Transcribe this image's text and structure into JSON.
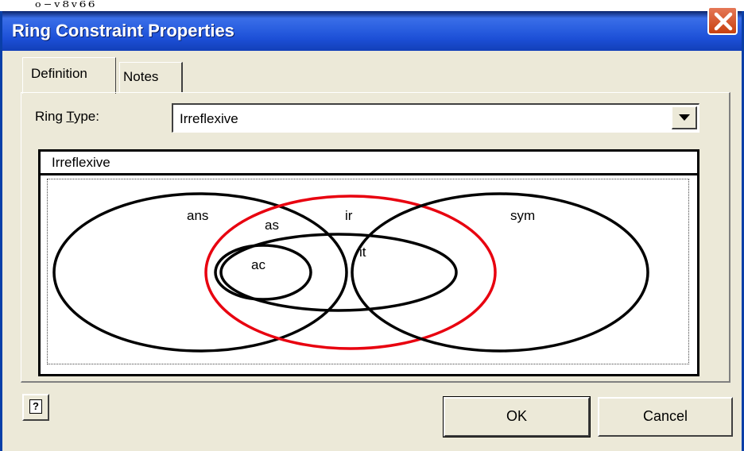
{
  "artifact_text": "ₒ₋ᵥ₈ᵥ₆₆",
  "window": {
    "title": "Ring Constraint Properties"
  },
  "tabs": [
    {
      "label": "Definition",
      "active": true
    },
    {
      "label": "Notes",
      "active": false
    }
  ],
  "ring_type": {
    "label_prefix": "Ring ",
    "label_accel": "T",
    "label_suffix": "ype:",
    "selected": "Irreflexive"
  },
  "diagram": {
    "header": "Irreflexive",
    "highlight_color": "#e8000f",
    "outline_color": "#000000",
    "sets": [
      {
        "id": "ans",
        "label": "ans"
      },
      {
        "id": "as",
        "label": "as"
      },
      {
        "id": "ir",
        "label": "ir",
        "highlighted": true
      },
      {
        "id": "sym",
        "label": "sym"
      },
      {
        "id": "it",
        "label": "it"
      },
      {
        "id": "ac",
        "label": "ac"
      }
    ]
  },
  "buttons": {
    "ok": "OK",
    "cancel": "Cancel",
    "help_glyph": "?"
  }
}
